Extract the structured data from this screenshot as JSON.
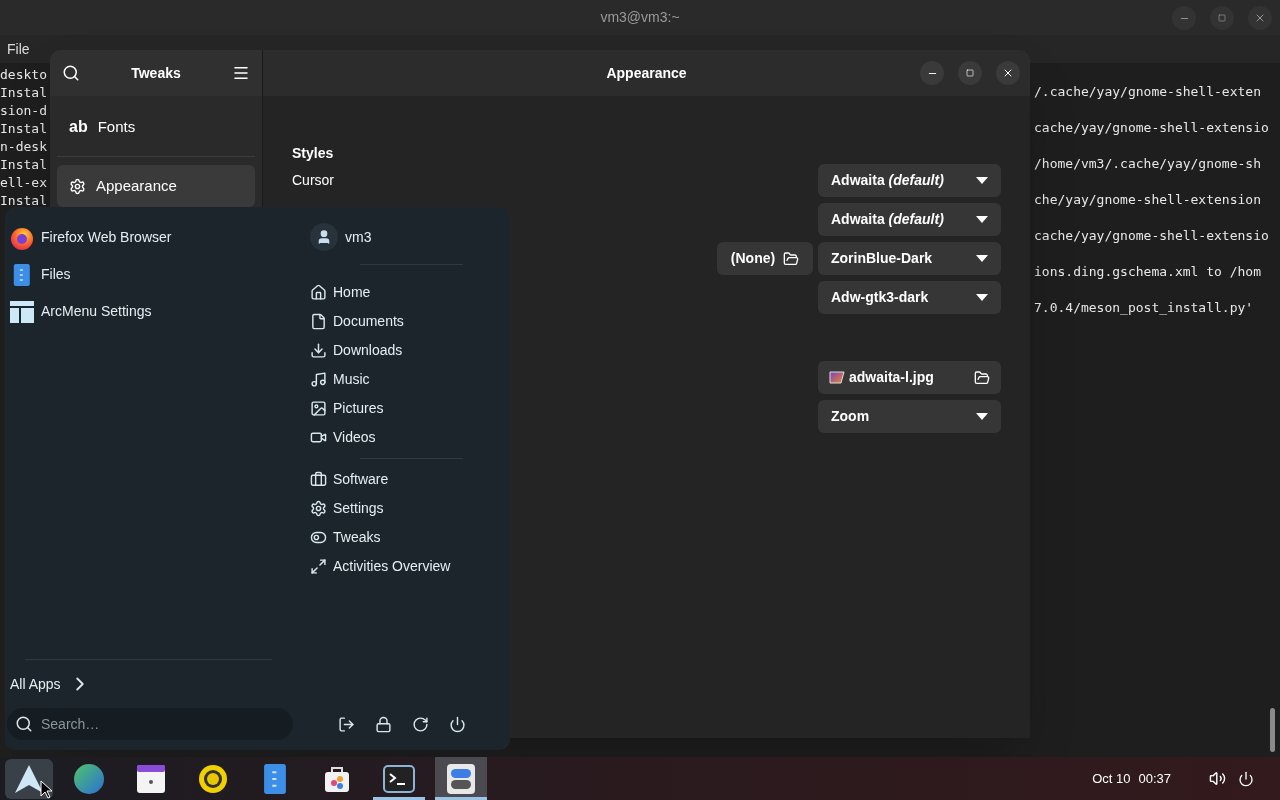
{
  "terminal": {
    "title": "vm3@vm3:~",
    "menu": [
      "File"
    ],
    "lines_left": [
      "deskto",
      "Instal",
      "sion-d",
      "Instal",
      "n-desk",
      "Instal",
      "ell-ex",
      "Instal"
    ],
    "lines_right": [
      "/.cache/yay/gnome-shell-exten",
      "cache/yay/gnome-shell-extensio",
      "/home/vm3/.cache/yay/gnome-sh",
      "che/yay/gnome-shell-extension",
      "cache/yay/gnome-shell-extensio",
      "ions.ding.gschema.xml to /hom",
      "7.0.4/meson_post_install.py'"
    ]
  },
  "tweaks": {
    "title": "Tweaks",
    "page_title": "Appearance",
    "sidebar": [
      {
        "label": "Fonts",
        "icon_text": "ab",
        "selected": false
      },
      {
        "label": "Appearance",
        "selected": true
      }
    ],
    "section": "Styles",
    "style_rows": [
      {
        "label": "Cursor",
        "kind": "dropdown",
        "value": "Adwaita *(default)*"
      },
      {
        "kind": "dropdown",
        "value": "Adwaita *(default)*"
      },
      {
        "kind": "dropdown",
        "value": "ZorinBlue-Dark",
        "side_button": "(None)"
      },
      {
        "kind": "dropdown",
        "value": "Adw-gtk3-dark"
      }
    ],
    "background_rows": [
      {
        "kind": "file",
        "value": "adwaita-l.jpg"
      },
      {
        "kind": "dropdown",
        "value": "Zoom"
      }
    ]
  },
  "arcmenu": {
    "apps": [
      "Firefox Web Browser",
      "Files",
      "ArcMenu Settings"
    ],
    "user": "vm3",
    "places": [
      "Home",
      "Documents",
      "Downloads",
      "Music",
      "Pictures",
      "Videos"
    ],
    "system": [
      "Software",
      "Settings",
      "Tweaks",
      "Activities Overview"
    ],
    "all_apps": "All Apps",
    "search": {
      "placeholder": "Search…"
    }
  },
  "taskbar": {
    "menu_button": {
      "open": true
    },
    "apps": [
      {
        "running": false,
        "focused": false
      },
      {
        "running": false,
        "focused": false
      },
      {
        "running": false,
        "focused": false
      },
      {
        "running": false,
        "focused": false
      },
      {
        "running": false,
        "focused": false
      },
      {
        "running": true,
        "focused": false
      },
      {
        "running": true,
        "focused": true
      }
    ],
    "date": "Oct 10",
    "time": "00:37"
  }
}
